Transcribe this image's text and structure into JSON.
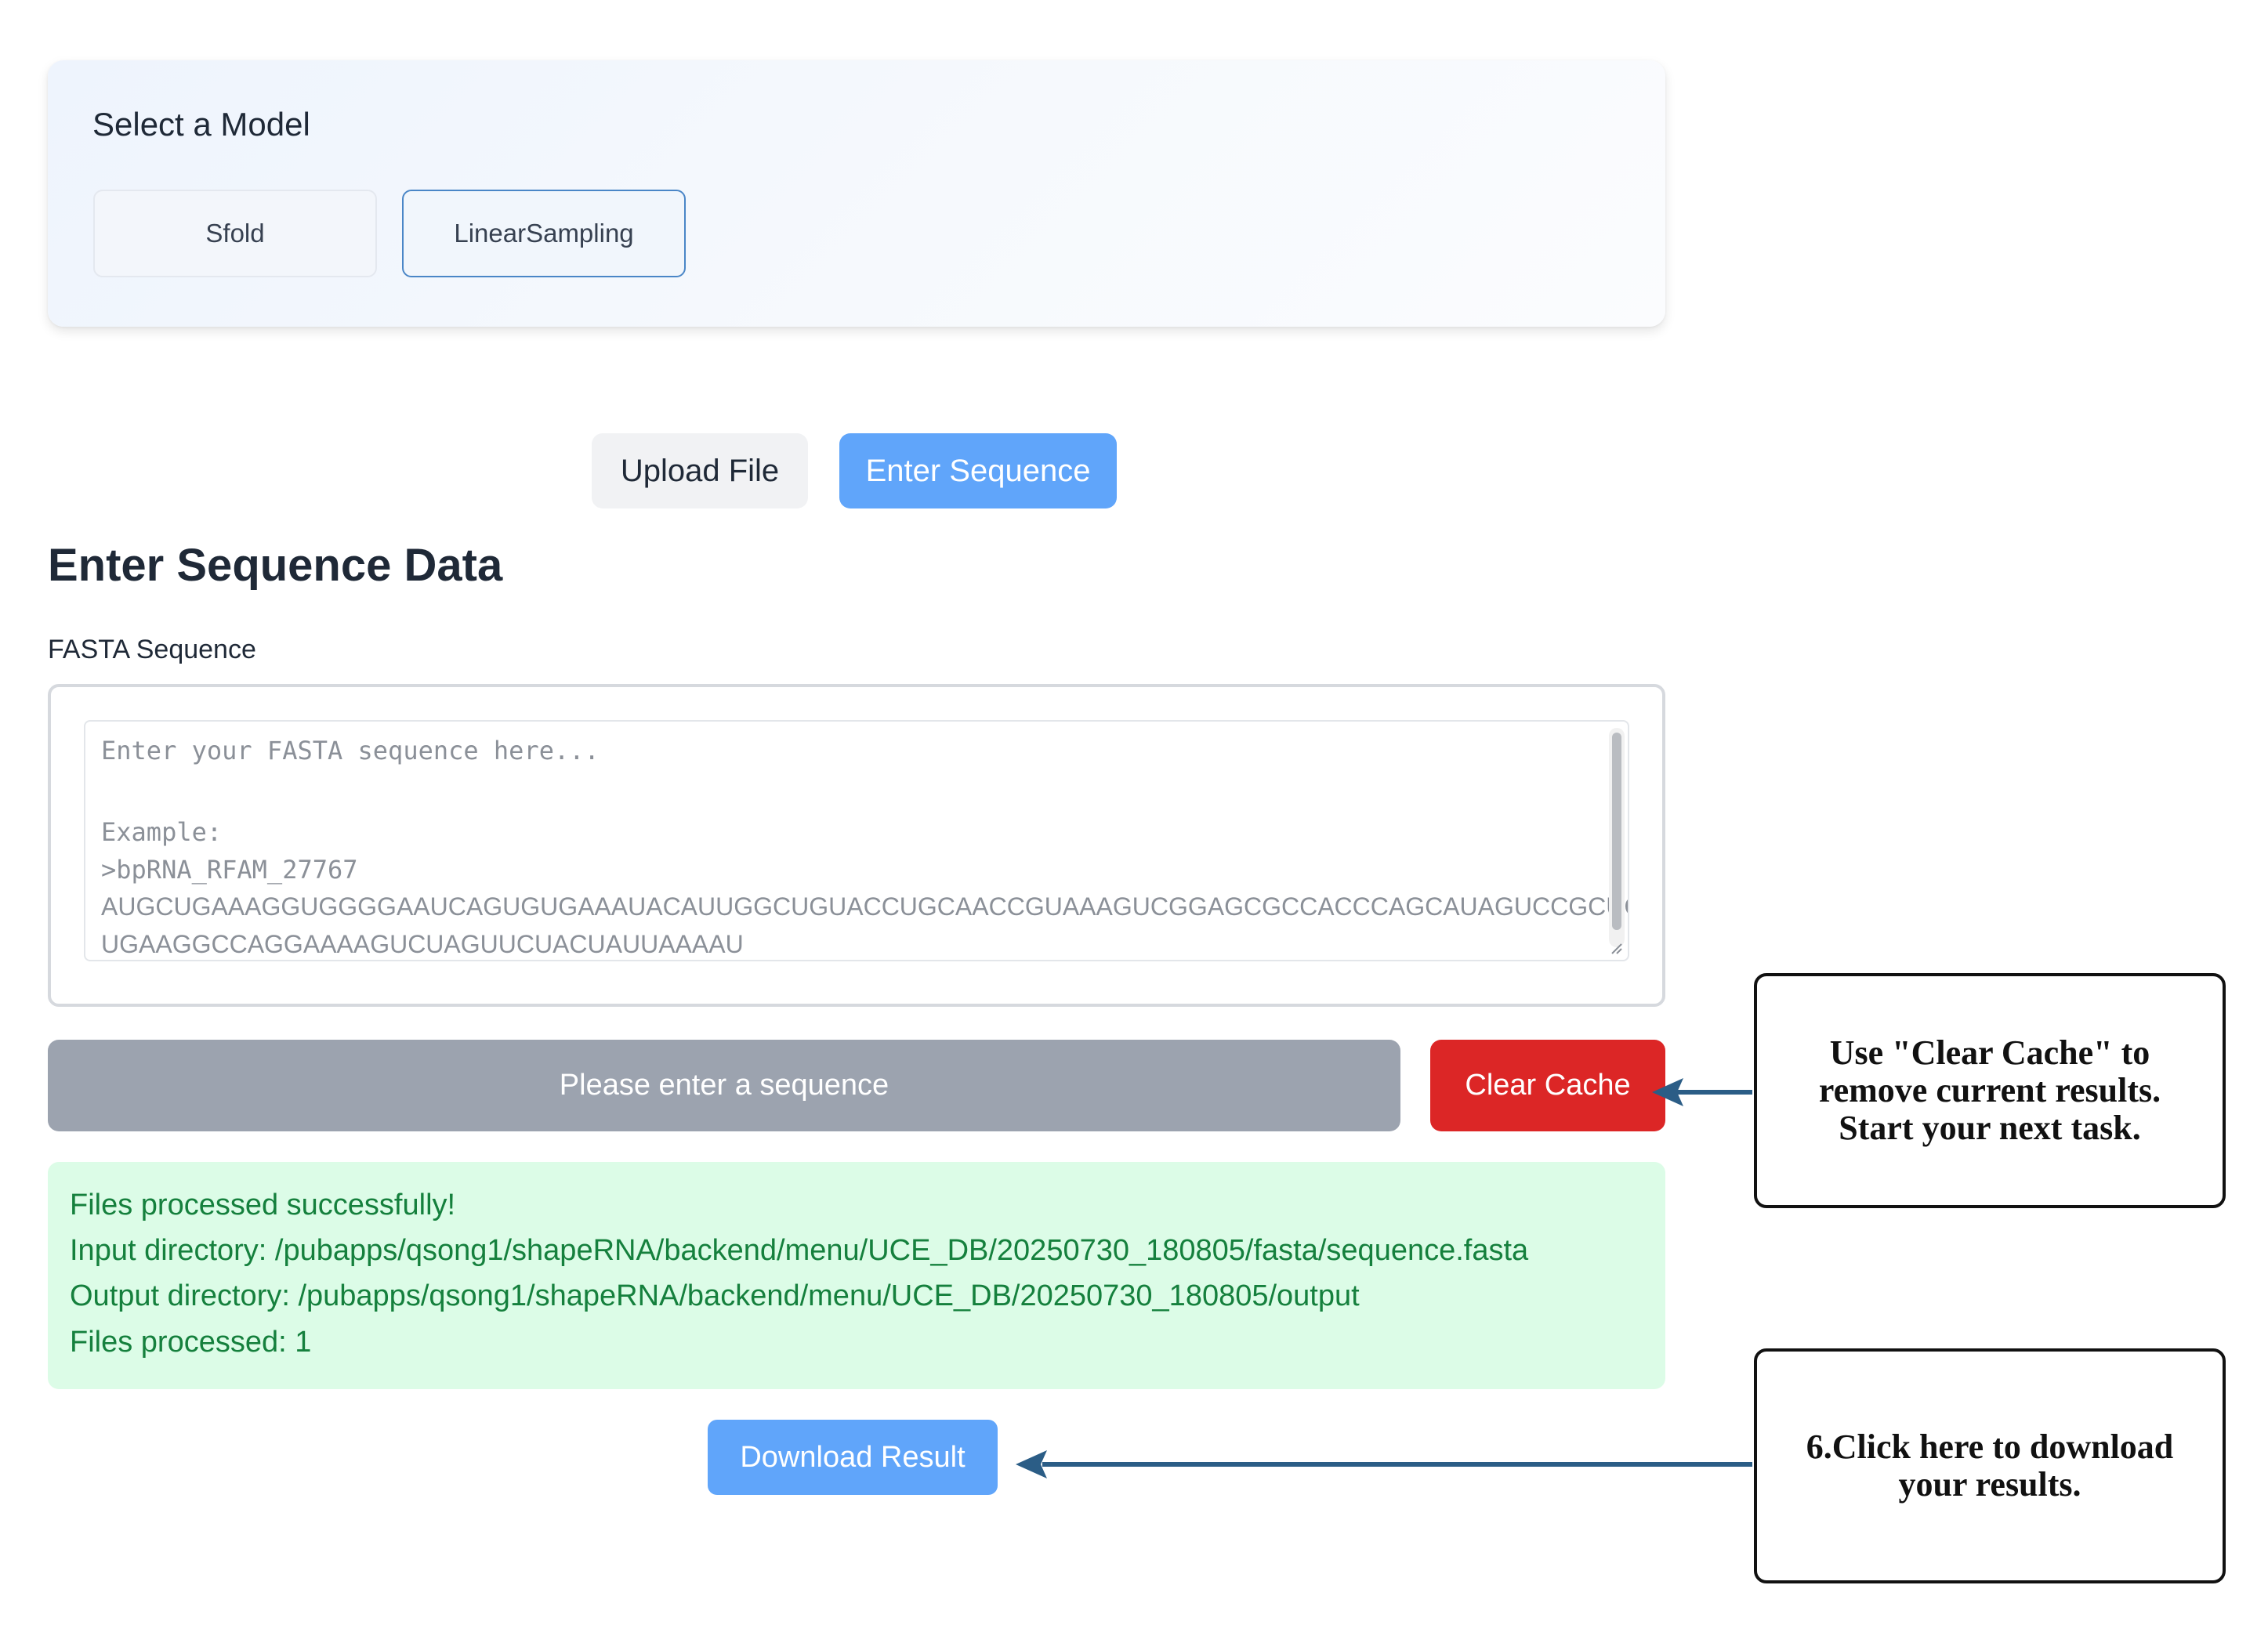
{
  "model_select": {
    "title": "Select a Model",
    "options": [
      "Sfold",
      "LinearSampling"
    ],
    "selected": "LinearSampling"
  },
  "input_mode": {
    "upload_label": "Upload File",
    "enter_label": "Enter Sequence",
    "active": "Enter Sequence"
  },
  "section": {
    "title": "Enter Sequence Data",
    "field_label": "FASTA Sequence"
  },
  "fasta": {
    "value": "",
    "placeholder_lines": [
      "Enter your FASTA sequence here...",
      "",
      "Example:",
      ">bpRNA_RFAM_27767",
      "AUGCUGAAAGGUGGGGAAUCAGUGUGAAAUACAUUGGCUGUACCUGCAACCGUAAAGUCGGAGCGCCACCCAGCAUAGUCCGCUGUUGAA",
      "UGAAGGCCAGGAAAAGUCUAGUUCUACUAUUAAAAU"
    ]
  },
  "actions": {
    "submit_label": "Please enter a sequence",
    "clear_label": "Clear Cache",
    "download_label": "Download Result"
  },
  "result": {
    "lines": [
      "Files processed successfully!",
      "Input directory: /pubapps/qsong1/shapeRNA/backend/menu/UCE_DB/20250730_180805/fasta/sequence.fasta",
      "Output directory: /pubapps/qsong1/shapeRNA/backend/menu/UCE_DB/20250730_180805/output",
      "Files processed: 1"
    ]
  },
  "annotations": {
    "clear_cache_note": [
      "Use \"Clear Cache\" to",
      "remove current results.",
      "Start your next task."
    ],
    "download_note": [
      "6.Click here to download",
      "your results."
    ]
  },
  "colors": {
    "accent_blue": "#60a5fa",
    "selected_border": "#4a86c7",
    "danger_red": "#dc2626",
    "disabled_gray": "#9ca3af",
    "success_bg": "#dcfce7",
    "success_text": "#15803d",
    "arrow": "#2b5d86"
  },
  "icons": {
    "textarea_resize": "resize-grip-icon",
    "callout_arrows": "arrow-left-icon"
  }
}
